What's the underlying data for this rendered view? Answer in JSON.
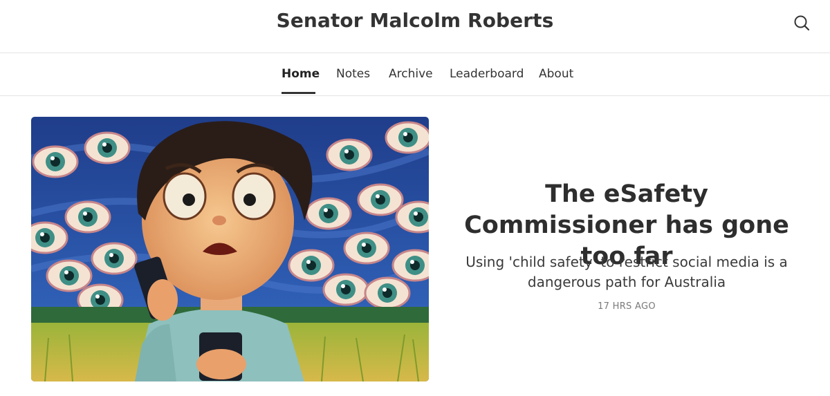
{
  "site": {
    "title": "Senator Malcolm Roberts"
  },
  "header": {
    "search_icon": "search-icon"
  },
  "nav": {
    "items": [
      {
        "label": "Home",
        "active": true
      },
      {
        "label": "Notes",
        "active": false
      },
      {
        "label": "Archive",
        "active": false
      },
      {
        "label": "Leaderboard",
        "active": false
      },
      {
        "label": "About",
        "active": false
      }
    ]
  },
  "featured_post": {
    "title": "The eSafety Commissioner has gone too far",
    "subtitle": "Using 'child safety' to restrict social media is a dangerous path for Australia",
    "date": "17 HRS AGO",
    "image_description_icon": "illustration-child-with-phones-and-eyes"
  },
  "colors": {
    "text": "#2e2e2e",
    "muted": "#7a7a7a",
    "divider": "#e3e3e3"
  }
}
